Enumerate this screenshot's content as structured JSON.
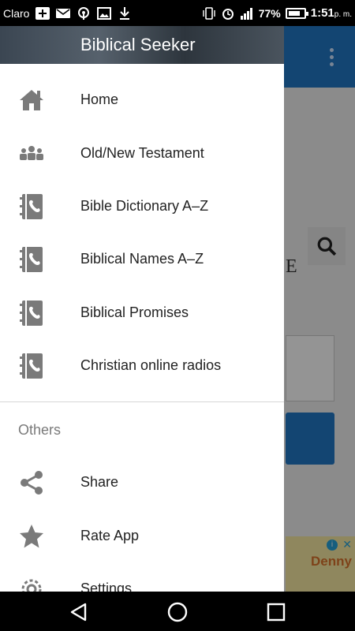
{
  "status_bar": {
    "carrier": "Claro",
    "battery_percent": "77%",
    "battery_level": 0.77,
    "time": "1:51",
    "time_suffix": "p. m."
  },
  "drawer": {
    "title": "Biblical Seeker",
    "items": [
      {
        "label": "Home",
        "icon": "home-icon"
      },
      {
        "label": "Old/New Testament",
        "icon": "people-icon"
      },
      {
        "label": "Bible Dictionary A–Z",
        "icon": "contact-book-icon"
      },
      {
        "label": "Biblical Names A–Z",
        "icon": "contact-book-icon"
      },
      {
        "label": "Biblical Promises",
        "icon": "contact-book-icon"
      },
      {
        "label": "Christian online radios",
        "icon": "contact-book-icon"
      }
    ],
    "others_label": "Others",
    "others": [
      {
        "label": "Share",
        "icon": "share-icon"
      },
      {
        "label": "Rate App",
        "icon": "star-icon"
      },
      {
        "label": "Settings",
        "icon": "gear-icon"
      }
    ]
  },
  "background": {
    "partial_letter": "E",
    "ad_text": "Denny",
    "toolbar_color": "#2277c4"
  }
}
